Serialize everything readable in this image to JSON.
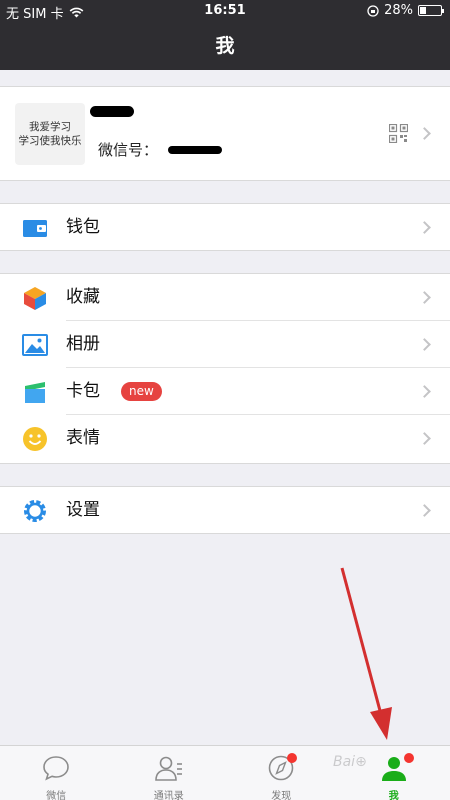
{
  "status_bar": {
    "carrier": "无 SIM 卡",
    "time": "16:51",
    "battery_percent": "28%",
    "battery_level": 0.28
  },
  "nav": {
    "title": "我"
  },
  "profile": {
    "avatar_line1": "我爱学习",
    "avatar_line2": "学习使我快乐",
    "wechat_id_label": "微信号："
  },
  "menu": {
    "wallet": "钱包",
    "favorites": "收藏",
    "album": "相册",
    "cards": "卡包",
    "cards_badge": "new",
    "stickers": "表情",
    "settings": "设置"
  },
  "tabbar": {
    "chats": "微信",
    "contacts": "通讯录",
    "discover": "发现",
    "me": "我"
  },
  "colors": {
    "accent": "#1aad19",
    "nav_bg": "#2e2d31",
    "badge": "#e64340",
    "arrow": "#d32f2f"
  }
}
